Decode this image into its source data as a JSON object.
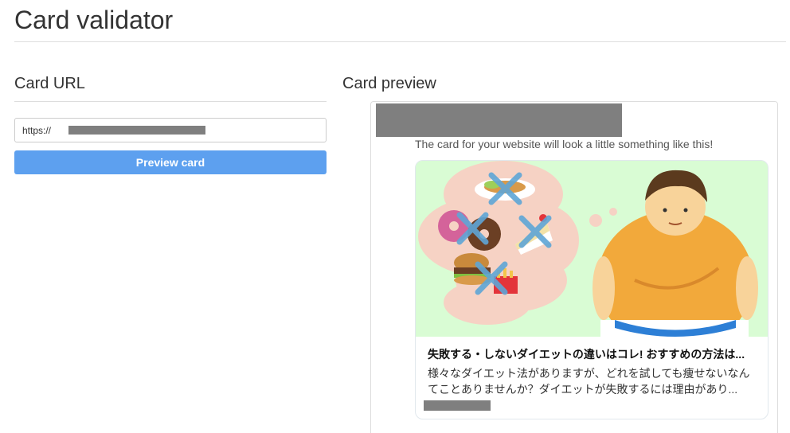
{
  "page": {
    "title": "Card validator"
  },
  "left": {
    "heading": "Card URL",
    "url_value": "https://",
    "preview_button_label": "Preview card"
  },
  "right": {
    "heading": "Card preview",
    "caption": "The card for your website will look a little something like this!",
    "card": {
      "title": "失敗する・しないダイエットの違いはコレ! おすすめの方法は...",
      "description": "様々なダイエット法がありますが、どれを試しても痩せないなんてことありませんか？ダイエットが失敗するには理由があり..."
    }
  },
  "colors": {
    "button": "#5da0ef",
    "image_background": "#d9fcd4",
    "redaction": "#7f7f7f"
  }
}
